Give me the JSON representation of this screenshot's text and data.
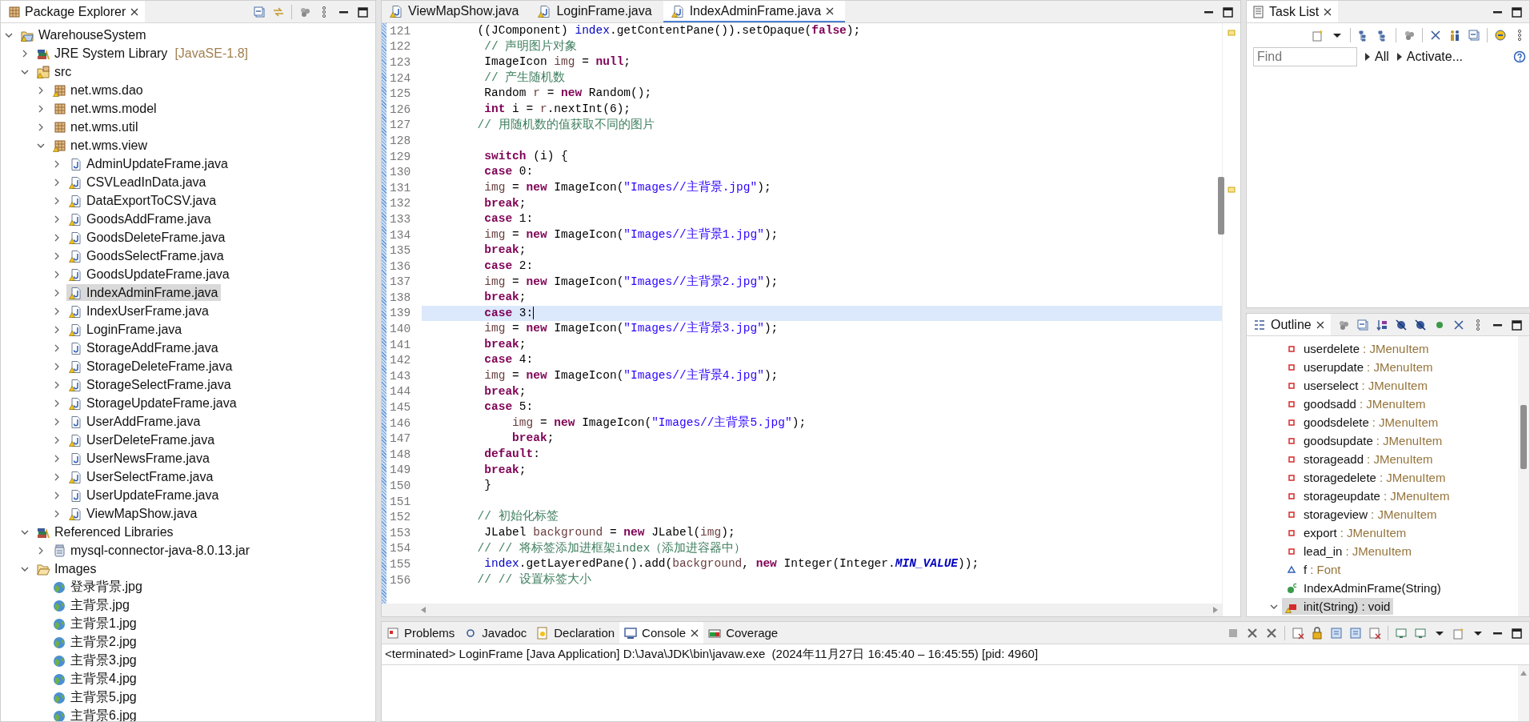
{
  "package_explorer": {
    "title": "Package Explorer",
    "tree": [
      {
        "label": "WarehouseSystem",
        "kind": "project",
        "warning": true,
        "selected": false,
        "expanded": true,
        "children": [
          {
            "label": "JRE System Library",
            "detail": "[JavaSE-1.8]",
            "kind": "library",
            "warning": false,
            "selected": false,
            "expanded": false
          },
          {
            "label": "src",
            "kind": "source-folder",
            "warning": true,
            "selected": false,
            "expanded": true,
            "children": [
              {
                "label": "net.wms.dao",
                "kind": "package",
                "warning": true,
                "selected": false,
                "expanded": false
              },
              {
                "label": "net.wms.model",
                "kind": "package",
                "warning": false,
                "selected": false,
                "expanded": false
              },
              {
                "label": "net.wms.util",
                "kind": "package",
                "warning": false,
                "selected": false,
                "expanded": false
              },
              {
                "label": "net.wms.view",
                "kind": "package",
                "warning": true,
                "selected": false,
                "expanded": true,
                "children": [
                  {
                    "label": "AdminUpdateFrame.java",
                    "kind": "java",
                    "warning": false,
                    "selected": false,
                    "expanded": false
                  },
                  {
                    "label": "CSVLeadInData.java",
                    "kind": "java",
                    "warning": true,
                    "selected": false,
                    "expanded": false
                  },
                  {
                    "label": "DataExportToCSV.java",
                    "kind": "java",
                    "warning": true,
                    "selected": false,
                    "expanded": false
                  },
                  {
                    "label": "GoodsAddFrame.java",
                    "kind": "java",
                    "warning": true,
                    "selected": false,
                    "expanded": false
                  },
                  {
                    "label": "GoodsDeleteFrame.java",
                    "kind": "java",
                    "warning": true,
                    "selected": false,
                    "expanded": false
                  },
                  {
                    "label": "GoodsSelectFrame.java",
                    "kind": "java",
                    "warning": true,
                    "selected": false,
                    "expanded": false
                  },
                  {
                    "label": "GoodsUpdateFrame.java",
                    "kind": "java",
                    "warning": true,
                    "selected": false,
                    "expanded": false
                  },
                  {
                    "label": "IndexAdminFrame.java",
                    "kind": "java",
                    "warning": true,
                    "selected": true,
                    "expanded": false
                  },
                  {
                    "label": "IndexUserFrame.java",
                    "kind": "java",
                    "warning": true,
                    "selected": false,
                    "expanded": false
                  },
                  {
                    "label": "LoginFrame.java",
                    "kind": "java",
                    "warning": true,
                    "selected": false,
                    "expanded": false
                  },
                  {
                    "label": "StorageAddFrame.java",
                    "kind": "java",
                    "warning": false,
                    "selected": false,
                    "expanded": false
                  },
                  {
                    "label": "StorageDeleteFrame.java",
                    "kind": "java",
                    "warning": true,
                    "selected": false,
                    "expanded": false
                  },
                  {
                    "label": "StorageSelectFrame.java",
                    "kind": "java",
                    "warning": true,
                    "selected": false,
                    "expanded": false
                  },
                  {
                    "label": "StorageUpdateFrame.java",
                    "kind": "java",
                    "warning": true,
                    "selected": false,
                    "expanded": false
                  },
                  {
                    "label": "UserAddFrame.java",
                    "kind": "java",
                    "warning": false,
                    "selected": false,
                    "expanded": false
                  },
                  {
                    "label": "UserDeleteFrame.java",
                    "kind": "java",
                    "warning": true,
                    "selected": false,
                    "expanded": false
                  },
                  {
                    "label": "UserNewsFrame.java",
                    "kind": "java",
                    "warning": false,
                    "selected": false,
                    "expanded": false
                  },
                  {
                    "label": "UserSelectFrame.java",
                    "kind": "java",
                    "warning": true,
                    "selected": false,
                    "expanded": false
                  },
                  {
                    "label": "UserUpdateFrame.java",
                    "kind": "java",
                    "warning": false,
                    "selected": false,
                    "expanded": false
                  },
                  {
                    "label": "ViewMapShow.java",
                    "kind": "java",
                    "warning": true,
                    "selected": false,
                    "expanded": false
                  }
                ]
              }
            ]
          },
          {
            "label": "Referenced Libraries",
            "kind": "library",
            "warning": false,
            "selected": false,
            "expanded": true,
            "children": [
              {
                "label": "mysql-connector-java-8.0.13.jar",
                "kind": "jar",
                "warning": false,
                "selected": false,
                "expanded": false
              }
            ]
          },
          {
            "label": "Images",
            "kind": "folder",
            "warning": false,
            "selected": false,
            "expanded": true,
            "children": [
              {
                "label": "登录背景.jpg",
                "kind": "image",
                "warning": false,
                "selected": false
              },
              {
                "label": "主背景.jpg",
                "kind": "image",
                "warning": false,
                "selected": false
              },
              {
                "label": "主背景1.jpg",
                "kind": "image",
                "warning": false,
                "selected": false
              },
              {
                "label": "主背景2.jpg",
                "kind": "image",
                "warning": false,
                "selected": false
              },
              {
                "label": "主背景3.jpg",
                "kind": "image",
                "warning": false,
                "selected": false
              },
              {
                "label": "主背景4.jpg",
                "kind": "image",
                "warning": false,
                "selected": false
              },
              {
                "label": "主背景5.jpg",
                "kind": "image",
                "warning": false,
                "selected": false
              },
              {
                "label": "主背景6.jpg",
                "kind": "image",
                "warning": false,
                "selected": false
              }
            ]
          }
        ]
      }
    ]
  },
  "editor": {
    "tabs": [
      {
        "label": "ViewMapShow.java",
        "warning": true,
        "selected": false
      },
      {
        "label": "LoginFrame.java",
        "warning": true,
        "selected": false
      },
      {
        "label": "IndexAdminFrame.java",
        "warning": true,
        "selected": true
      }
    ],
    "lines": [
      {
        "number": "121",
        "current": false,
        "tokens": [
          {
            "text": "        ((JComponent) ",
            "kind": "plain"
          },
          {
            "text": "index",
            "kind": "field"
          },
          {
            "text": ".getContentPane()).setOpaque(",
            "kind": "plain"
          },
          {
            "text": "false",
            "kind": "keyword"
          },
          {
            "text": ");",
            "kind": "plain"
          }
        ]
      },
      {
        "number": "122",
        "current": false,
        "tokens": [
          {
            "text": "         // 声明图片对象",
            "kind": "comment"
          }
        ]
      },
      {
        "number": "123",
        "current": false,
        "tokens": [
          {
            "text": "         ImageIcon ",
            "kind": "plain"
          },
          {
            "text": "img",
            "kind": "local"
          },
          {
            "text": " = ",
            "kind": "plain"
          },
          {
            "text": "null",
            "kind": "keyword"
          },
          {
            "text": ";",
            "kind": "plain"
          }
        ]
      },
      {
        "number": "124",
        "current": false,
        "tokens": [
          {
            "text": "         // 产生随机数",
            "kind": "comment"
          }
        ]
      },
      {
        "number": "125",
        "current": false,
        "tokens": [
          {
            "text": "         Random ",
            "kind": "plain"
          },
          {
            "text": "r",
            "kind": "local"
          },
          {
            "text": " = ",
            "kind": "plain"
          },
          {
            "text": "new",
            "kind": "keyword"
          },
          {
            "text": " Random();",
            "kind": "plain"
          }
        ]
      },
      {
        "number": "126",
        "current": false,
        "tokens": [
          {
            "text": "         int",
            "kind": "keyword"
          },
          {
            "text": " i = ",
            "kind": "plain"
          },
          {
            "text": "r",
            "kind": "local"
          },
          {
            "text": ".nextInt(6);",
            "kind": "plain"
          }
        ]
      },
      {
        "number": "127",
        "current": false,
        "tokens": [
          {
            "text": "        // 用随机数的值获取不同的图片",
            "kind": "comment"
          }
        ]
      },
      {
        "number": "128",
        "current": false
      },
      {
        "number": "129",
        "current": false,
        "tokens": [
          {
            "text": "         switch",
            "kind": "keyword"
          },
          {
            "text": " (i) {",
            "kind": "plain"
          }
        ]
      },
      {
        "number": "130",
        "current": false,
        "tokens": [
          {
            "text": "         case",
            "kind": "keyword"
          },
          {
            "text": " 0:",
            "kind": "plain"
          }
        ]
      },
      {
        "number": "131",
        "current": false,
        "tokens": [
          {
            "text": "         img",
            "kind": "local"
          },
          {
            "text": " = ",
            "kind": "plain"
          },
          {
            "text": "new",
            "kind": "keyword"
          },
          {
            "text": " ImageIcon(",
            "kind": "plain"
          },
          {
            "text": "\"Images//主背景.jpg\"",
            "kind": "string"
          },
          {
            "text": ");",
            "kind": "plain"
          }
        ]
      },
      {
        "number": "132",
        "current": false,
        "tokens": [
          {
            "text": "         break",
            "kind": "keyword"
          },
          {
            "text": ";",
            "kind": "plain"
          }
        ]
      },
      {
        "number": "133",
        "current": false,
        "tokens": [
          {
            "text": "         case",
            "kind": "keyword"
          },
          {
            "text": " 1:",
            "kind": "plain"
          }
        ]
      },
      {
        "number": "134",
        "current": false,
        "tokens": [
          {
            "text": "         img",
            "kind": "local"
          },
          {
            "text": " = ",
            "kind": "plain"
          },
          {
            "text": "new",
            "kind": "keyword"
          },
          {
            "text": " ImageIcon(",
            "kind": "plain"
          },
          {
            "text": "\"Images//主背景1.jpg\"",
            "kind": "string"
          },
          {
            "text": ");",
            "kind": "plain"
          }
        ]
      },
      {
        "number": "135",
        "current": false,
        "tokens": [
          {
            "text": "         break",
            "kind": "keyword"
          },
          {
            "text": ";",
            "kind": "plain"
          }
        ]
      },
      {
        "number": "136",
        "current": false,
        "tokens": [
          {
            "text": "         case",
            "kind": "keyword"
          },
          {
            "text": " 2:",
            "kind": "plain"
          }
        ]
      },
      {
        "number": "137",
        "current": false,
        "tokens": [
          {
            "text": "         img",
            "kind": "local"
          },
          {
            "text": " = ",
            "kind": "plain"
          },
          {
            "text": "new",
            "kind": "keyword"
          },
          {
            "text": " ImageIcon(",
            "kind": "plain"
          },
          {
            "text": "\"Images//主背景2.jpg\"",
            "kind": "string"
          },
          {
            "text": ");",
            "kind": "plain"
          }
        ]
      },
      {
        "number": "138",
        "current": false,
        "tokens": [
          {
            "text": "         break",
            "kind": "keyword"
          },
          {
            "text": ";",
            "kind": "plain"
          }
        ]
      },
      {
        "number": "139",
        "current": true,
        "tokens": [
          {
            "text": "         case",
            "kind": "keyword"
          },
          {
            "text": " 3:",
            "kind": "plain"
          }
        ]
      },
      {
        "number": "140",
        "current": false,
        "tokens": [
          {
            "text": "         img",
            "kind": "local"
          },
          {
            "text": " = ",
            "kind": "plain"
          },
          {
            "text": "new",
            "kind": "keyword"
          },
          {
            "text": " ImageIcon(",
            "kind": "plain"
          },
          {
            "text": "\"Images//主背景3.jpg\"",
            "kind": "string"
          },
          {
            "text": ");",
            "kind": "plain"
          }
        ]
      },
      {
        "number": "141",
        "current": false,
        "tokens": [
          {
            "text": "         break",
            "kind": "keyword"
          },
          {
            "text": ";",
            "kind": "plain"
          }
        ]
      },
      {
        "number": "142",
        "current": false,
        "tokens": [
          {
            "text": "         case",
            "kind": "keyword"
          },
          {
            "text": " 4:",
            "kind": "plain"
          }
        ]
      },
      {
        "number": "143",
        "current": false,
        "tokens": [
          {
            "text": "         img",
            "kind": "local"
          },
          {
            "text": " = ",
            "kind": "plain"
          },
          {
            "text": "new",
            "kind": "keyword"
          },
          {
            "text": " ImageIcon(",
            "kind": "plain"
          },
          {
            "text": "\"Images//主背景4.jpg\"",
            "kind": "string"
          },
          {
            "text": ");",
            "kind": "plain"
          }
        ]
      },
      {
        "number": "144",
        "current": false,
        "tokens": [
          {
            "text": "         break",
            "kind": "keyword"
          },
          {
            "text": ";",
            "kind": "plain"
          }
        ]
      },
      {
        "number": "145",
        "current": false,
        "tokens": [
          {
            "text": "         case",
            "kind": "keyword"
          },
          {
            "text": " 5:",
            "kind": "plain"
          }
        ]
      },
      {
        "number": "146",
        "current": false,
        "tokens": [
          {
            "text": "             img",
            "kind": "local"
          },
          {
            "text": " = ",
            "kind": "plain"
          },
          {
            "text": "new",
            "kind": "keyword"
          },
          {
            "text": " ImageIcon(",
            "kind": "plain"
          },
          {
            "text": "\"Images//主背景5.jpg\"",
            "kind": "string"
          },
          {
            "text": ");",
            "kind": "plain"
          }
        ]
      },
      {
        "number": "147",
        "current": false,
        "tokens": [
          {
            "text": "             break",
            "kind": "keyword"
          },
          {
            "text": ";",
            "kind": "plain"
          }
        ]
      },
      {
        "number": "148",
        "current": false,
        "tokens": [
          {
            "text": "         default",
            "kind": "keyword"
          },
          {
            "text": ":",
            "kind": "plain"
          }
        ]
      },
      {
        "number": "149",
        "current": false,
        "tokens": [
          {
            "text": "         break",
            "kind": "keyword"
          },
          {
            "text": ";",
            "kind": "plain"
          }
        ]
      },
      {
        "number": "150",
        "current": false,
        "tokens": [
          {
            "text": "         }",
            "kind": "plain"
          }
        ]
      },
      {
        "number": "151",
        "current": false
      },
      {
        "number": "152",
        "current": false,
        "tokens": [
          {
            "text": "        // 初始化标签",
            "kind": "comment"
          }
        ]
      },
      {
        "number": "153",
        "current": false,
        "tokens": [
          {
            "text": "         JLabel ",
            "kind": "plain"
          },
          {
            "text": "background",
            "kind": "local"
          },
          {
            "text": " = ",
            "kind": "plain"
          },
          {
            "text": "new",
            "kind": "keyword"
          },
          {
            "text": " JLabel(",
            "kind": "plain"
          },
          {
            "text": "img",
            "kind": "local"
          },
          {
            "text": ");",
            "kind": "plain"
          }
        ]
      },
      {
        "number": "154",
        "current": false,
        "tokens": [
          {
            "text": "        // // 将标签添加进框架index（添加进容器中）",
            "kind": "comment"
          }
        ]
      },
      {
        "number": "155",
        "current": false,
        "tokens": [
          {
            "text": "         index",
            "kind": "field"
          },
          {
            "text": ".getLayeredPane().add(",
            "kind": "plain"
          },
          {
            "text": "background",
            "kind": "local"
          },
          {
            "text": ", ",
            "kind": "plain"
          },
          {
            "text": "new",
            "kind": "keyword"
          },
          {
            "text": " Integer(Integer.",
            "kind": "plain"
          },
          {
            "text": "MIN_VALUE",
            "kind": "static"
          },
          {
            "text": "));",
            "kind": "plain"
          }
        ]
      },
      {
        "number": "156",
        "current": false,
        "tokens": [
          {
            "text": "        // // 设置标签大小",
            "kind": "comment"
          }
        ]
      }
    ]
  },
  "task_list": {
    "title": "Task List",
    "find": {
      "placeholder": "Find"
    },
    "filters": [
      "All",
      "Activate..."
    ]
  },
  "outline": {
    "title": "Outline",
    "items": [
      {
        "name": "userdelete",
        "type": ": JMenuItem",
        "kind": "private-field",
        "warning": false,
        "selected": false
      },
      {
        "name": "userupdate",
        "type": ": JMenuItem",
        "kind": "private-field",
        "warning": false,
        "selected": false
      },
      {
        "name": "userselect",
        "type": ": JMenuItem",
        "kind": "private-field",
        "warning": false,
        "selected": false
      },
      {
        "name": "goodsadd",
        "type": ": JMenuItem",
        "kind": "private-field",
        "warning": false,
        "selected": false
      },
      {
        "name": "goodsdelete",
        "type": ": JMenuItem",
        "kind": "private-field",
        "warning": false,
        "selected": false
      },
      {
        "name": "goodsupdate",
        "type": ": JMenuItem",
        "kind": "private-field",
        "warning": false,
        "selected": false
      },
      {
        "name": "storageadd",
        "type": ": JMenuItem",
        "kind": "private-field",
        "warning": false,
        "selected": false
      },
      {
        "name": "storagedelete",
        "type": ": JMenuItem",
        "kind": "private-field",
        "warning": false,
        "selected": false
      },
      {
        "name": "storageupdate",
        "type": ": JMenuItem",
        "kind": "private-field",
        "warning": false,
        "selected": false
      },
      {
        "name": "storageview",
        "type": ": JMenuItem",
        "kind": "private-field",
        "warning": false,
        "selected": false
      },
      {
        "name": "export",
        "type": ": JMenuItem",
        "kind": "private-field",
        "warning": false,
        "selected": false
      },
      {
        "name": "lead_in",
        "type": ": JMenuItem",
        "kind": "private-field",
        "warning": false,
        "selected": false
      },
      {
        "name": "f",
        "type": ": Font",
        "kind": "default-field",
        "warning": false,
        "selected": false
      },
      {
        "name": "IndexAdminFrame(String)",
        "kind": "constructor",
        "warning": false,
        "selected": false
      },
      {
        "name": "init(String) : void",
        "kind": "method",
        "warning": true,
        "selected": true,
        "expanded": true
      }
    ]
  },
  "bottom_panel": {
    "tabs": [
      {
        "label": "Problems",
        "kind": "problems",
        "selected": false
      },
      {
        "label": "Javadoc",
        "kind": "javadoc",
        "selected": false
      },
      {
        "label": "Declaration",
        "kind": "declaration",
        "selected": false
      },
      {
        "label": "Console",
        "kind": "console",
        "selected": true
      },
      {
        "label": "Coverage",
        "kind": "coverage",
        "selected": false
      }
    ],
    "console": {
      "status": "<terminated> LoginFrame [Java Application] D:\\Java\\JDK\\bin\\javaw.exe  (2024年11月27日 16:45:40 – 16:45:55) [pid: 4960]"
    }
  }
}
